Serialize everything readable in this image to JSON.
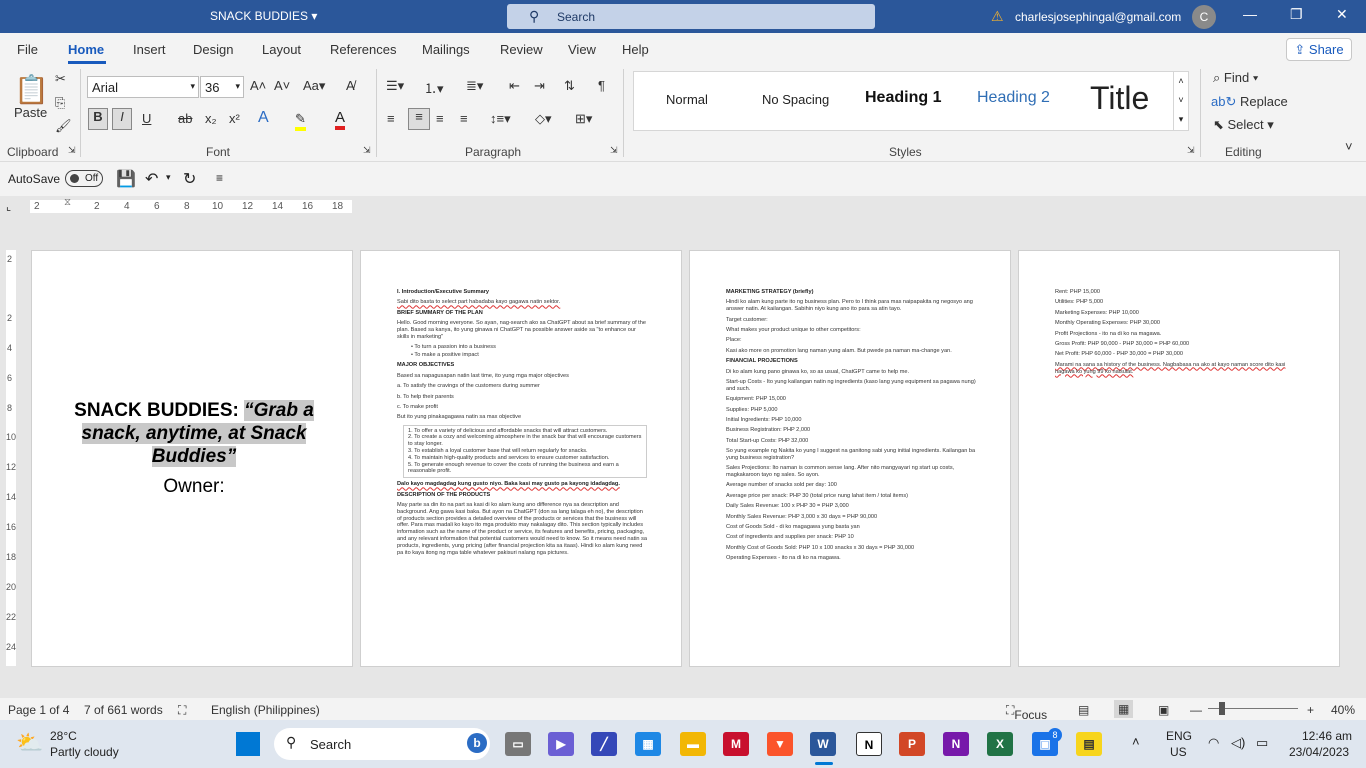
{
  "titlebar": {
    "doc_title": "SNACK BUDDIES",
    "search": "Search",
    "account": "charlesjosephingal@gmail.com",
    "avatar": "C"
  },
  "menu": {
    "tabs": [
      "File",
      "Home",
      "Insert",
      "Design",
      "Layout",
      "References",
      "Mailings",
      "Review",
      "View",
      "Help"
    ],
    "share": "Share"
  },
  "ribbon": {
    "clipboard": {
      "label": "Clipboard",
      "paste": "Paste"
    },
    "font": {
      "label": "Font",
      "name": "Arial",
      "size": "36"
    },
    "paragraph": {
      "label": "Paragraph"
    },
    "styles": {
      "label": "Styles",
      "items": [
        "Normal",
        "No Spacing",
        "Heading 1",
        "Heading 2",
        "Title"
      ]
    },
    "editing": {
      "label": "Editing",
      "find": "Find",
      "replace": "Replace",
      "select": "Select"
    }
  },
  "autosave": {
    "label": "AutoSave",
    "state": "Off"
  },
  "ruler": {
    "ticks": [
      "2",
      "2",
      "4",
      "6",
      "8",
      "10",
      "12",
      "14",
      "16",
      "18"
    ],
    "vticks": [
      "2",
      "2",
      "4",
      "6",
      "8",
      "10",
      "12",
      "14",
      "16",
      "18",
      "20",
      "22",
      "24"
    ]
  },
  "page1": {
    "title_bold": "SNACK BUDDIES:",
    "title_tagline": "“Grab a snack, anytime, at Snack Buddies”",
    "owner": "Owner:"
  },
  "page2": {
    "h1": "I. Introduction/Executive Summary",
    "l1": "Sabi dito basta to select part habadaba kayo gagawa natin sektor.",
    "h2": "BRIEF SUMMARY OF THE PLAN",
    "p1": "Hello. Good morning everyone. So ayan, nag-search ako sa ChatGPT about sa brief summary of the plan. Based sa kanya, ito yung ginawa ni ChatGPT na possible answer aside sa \"to enhance our skills in marketing\"",
    "b1": "To turn a passion into a business",
    "b2": "To make a positive impact",
    "h3": "MAJOR OBJECTIVES",
    "p2": "Based sa napagusapan natin last time, ito yung mga major objectives",
    "oa": "a. To satisfy the cravings of the customers during summer",
    "ob": "b. To help their parents",
    "oc": "c. To make profit",
    "p3": "But ito yung pinakagagawa natin sa max objective",
    "n1": "To offer a variety of delicious and affordable snacks that will attract customers.",
    "n2": "To create a cozy and welcoming atmosphere in the snack bar that will encourage customers to stay longer.",
    "n3": "To establish a loyal customer base that will return regularly for snacks.",
    "n4": "To maintain high-quality products and services to ensure customer satisfaction.",
    "n5": "To generate enough revenue to cover the costs of running the business and earn a reasonable profit.",
    "p4": "Dalo kayo magdagdag kung gusto niyo. Baka kasi may gusto pa kayong idadagdag.",
    "h4": "DESCRIPTION OF THE PRODUCTS",
    "p5": "May parte sa din ito na part sa kasi di ko alam kung ano difference nya sa description and background. Ang gawa kasi baka. But ayon na ChatGPT (don sa lang talaga eh no), the description of products section provides a detailed overview of the products or services that the business will offer. Para mas madali ko kayo ito mga produkto may nakalagay dito. This section typically includes information such as the name of the product or service, its features and benefits, pricing, packaging, and any relevant information that potential customers would need to know. So it means need natin sa products, ingredients, yung pricing (after financial projection kita sa itaas). Hindi ko alam kung need pa ito kaya itong ng mga table whatever pakisuri nalang nga pictures."
  },
  "page3": {
    "h1": "MARKETING STRATEGY (briefly)",
    "p1": "Hindi ko alam kung parte ito ng business plan. Pero to I think para mas naipapakita ng negosyo ang answer natin. At kailangan. Sabihin niyo kung ano ito para sa atin tayo.",
    "l1": "Target customer:",
    "l2": "What makes your product unique to other competitors:",
    "l3": "Place:",
    "p2": "Kasi ako more on promotion lang naman yung alam. But pwede pa naman ma-change yan.",
    "h2": "FINANCIAL PROJECTIONS",
    "p3": "Di ko alam kung pano ginawa ko, so as usual, ChatGPT came to help me.",
    "p4": "Start-up Costs - Ito yung kailangan natin ng ingredients (kaso lang yung equipment sa pagawa nung) and such.",
    "e1": "Equipment: PHP 15,000",
    "e2": "Supplies: PHP 5,000",
    "e3": "Initial Ingredients: PHP 10,000",
    "e4": "Business Registration: PHP 2,000",
    "e5": "Total Start-up Costs: PHP 32,000",
    "p5": "So yung example ng Nakita ko yung I suggest na ganitong sabi yung initial ingredients. Kailangan ba yung business registration?",
    "p6": "Sales Projections: Ito naman is common sense lang. After nito mangyayari ng start up costs, magkakaroon tayo ng sales. So ayon.",
    "s1": "Average number of snacks sold per day: 100",
    "s2": "Average price per snack: PHP 30 (total price nung lahat item / total items)",
    "s3": "Daily Sales Revenue: 100 x PHP 30 = PHP 3,000",
    "s4": "Monthly Sales Revenue: PHP 3,000 x 30 days = PHP 90,000",
    "s5": "Cost of Goods Sold - di ko magagawa yung basta yan",
    "s6": "Cost of ingredients and supplies per snack: PHP 10",
    "s7": "Monthly Cost of Goods Sold: PHP 10 x 100 snacks x 30 days = PHP 30,000",
    "s8": "Operating Expenses - ito na di ko na magawa."
  },
  "page4": {
    "r1": "Rent: PHP 15,000",
    "r2": "Utilities: PHP 5,000",
    "r3": "Marketing Expenses: PHP 10,000",
    "r4": "Monthly Operating Expenses: PHP 30,000",
    "r5": "Profit Projections - ito na di ko na magawa.",
    "r6": "Gross Profit: PHP 90,000 - PHP 30,000 = PHP 60,000",
    "r7": "Net Profit: PHP 60,000 - PHP 30,000 = PHP 30,000",
    "r8": "Marami na sana sa history of the business. Nagbabasa na ako at kayo naman score dito kasi nagawa ko yung 99 ko naisulat."
  },
  "status": {
    "page": "Page 1 of 4",
    "words": "7 of 661 words",
    "language": "English (Philippines)",
    "focus": "Focus",
    "zoom": "40%"
  },
  "taskbar": {
    "temp": "28°C",
    "weather": "Partly cloudy",
    "search": "Search",
    "lang1": "ENG",
    "lang2": "US",
    "time": "12:46 am",
    "date": "23/04/2023",
    "badge": "8"
  }
}
